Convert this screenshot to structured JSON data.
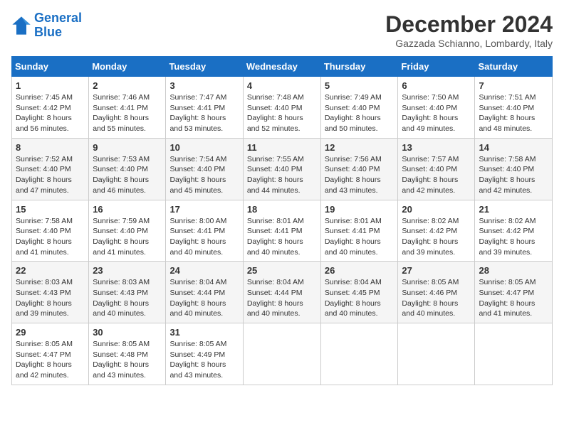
{
  "logo": {
    "line1": "General",
    "line2": "Blue"
  },
  "title": "December 2024",
  "subtitle": "Gazzada Schianno, Lombardy, Italy",
  "weekdays": [
    "Sunday",
    "Monday",
    "Tuesday",
    "Wednesday",
    "Thursday",
    "Friday",
    "Saturday"
  ],
  "weeks": [
    [
      {
        "day": "1",
        "sunrise": "7:45 AM",
        "sunset": "4:42 PM",
        "daylight": "8 hours and 56 minutes."
      },
      {
        "day": "2",
        "sunrise": "7:46 AM",
        "sunset": "4:41 PM",
        "daylight": "8 hours and 55 minutes."
      },
      {
        "day": "3",
        "sunrise": "7:47 AM",
        "sunset": "4:41 PM",
        "daylight": "8 hours and 53 minutes."
      },
      {
        "day": "4",
        "sunrise": "7:48 AM",
        "sunset": "4:40 PM",
        "daylight": "8 hours and 52 minutes."
      },
      {
        "day": "5",
        "sunrise": "7:49 AM",
        "sunset": "4:40 PM",
        "daylight": "8 hours and 50 minutes."
      },
      {
        "day": "6",
        "sunrise": "7:50 AM",
        "sunset": "4:40 PM",
        "daylight": "8 hours and 49 minutes."
      },
      {
        "day": "7",
        "sunrise": "7:51 AM",
        "sunset": "4:40 PM",
        "daylight": "8 hours and 48 minutes."
      }
    ],
    [
      {
        "day": "8",
        "sunrise": "7:52 AM",
        "sunset": "4:40 PM",
        "daylight": "8 hours and 47 minutes."
      },
      {
        "day": "9",
        "sunrise": "7:53 AM",
        "sunset": "4:40 PM",
        "daylight": "8 hours and 46 minutes."
      },
      {
        "day": "10",
        "sunrise": "7:54 AM",
        "sunset": "4:40 PM",
        "daylight": "8 hours and 45 minutes."
      },
      {
        "day": "11",
        "sunrise": "7:55 AM",
        "sunset": "4:40 PM",
        "daylight": "8 hours and 44 minutes."
      },
      {
        "day": "12",
        "sunrise": "7:56 AM",
        "sunset": "4:40 PM",
        "daylight": "8 hours and 43 minutes."
      },
      {
        "day": "13",
        "sunrise": "7:57 AM",
        "sunset": "4:40 PM",
        "daylight": "8 hours and 42 minutes."
      },
      {
        "day": "14",
        "sunrise": "7:58 AM",
        "sunset": "4:40 PM",
        "daylight": "8 hours and 42 minutes."
      }
    ],
    [
      {
        "day": "15",
        "sunrise": "7:58 AM",
        "sunset": "4:40 PM",
        "daylight": "8 hours and 41 minutes."
      },
      {
        "day": "16",
        "sunrise": "7:59 AM",
        "sunset": "4:40 PM",
        "daylight": "8 hours and 41 minutes."
      },
      {
        "day": "17",
        "sunrise": "8:00 AM",
        "sunset": "4:41 PM",
        "daylight": "8 hours and 40 minutes."
      },
      {
        "day": "18",
        "sunrise": "8:01 AM",
        "sunset": "4:41 PM",
        "daylight": "8 hours and 40 minutes."
      },
      {
        "day": "19",
        "sunrise": "8:01 AM",
        "sunset": "4:41 PM",
        "daylight": "8 hours and 40 minutes."
      },
      {
        "day": "20",
        "sunrise": "8:02 AM",
        "sunset": "4:42 PM",
        "daylight": "8 hours and 39 minutes."
      },
      {
        "day": "21",
        "sunrise": "8:02 AM",
        "sunset": "4:42 PM",
        "daylight": "8 hours and 39 minutes."
      }
    ],
    [
      {
        "day": "22",
        "sunrise": "8:03 AM",
        "sunset": "4:43 PM",
        "daylight": "8 hours and 39 minutes."
      },
      {
        "day": "23",
        "sunrise": "8:03 AM",
        "sunset": "4:43 PM",
        "daylight": "8 hours and 40 minutes."
      },
      {
        "day": "24",
        "sunrise": "8:04 AM",
        "sunset": "4:44 PM",
        "daylight": "8 hours and 40 minutes."
      },
      {
        "day": "25",
        "sunrise": "8:04 AM",
        "sunset": "4:44 PM",
        "daylight": "8 hours and 40 minutes."
      },
      {
        "day": "26",
        "sunrise": "8:04 AM",
        "sunset": "4:45 PM",
        "daylight": "8 hours and 40 minutes."
      },
      {
        "day": "27",
        "sunrise": "8:05 AM",
        "sunset": "4:46 PM",
        "daylight": "8 hours and 40 minutes."
      },
      {
        "day": "28",
        "sunrise": "8:05 AM",
        "sunset": "4:47 PM",
        "daylight": "8 hours and 41 minutes."
      }
    ],
    [
      {
        "day": "29",
        "sunrise": "8:05 AM",
        "sunset": "4:47 PM",
        "daylight": "8 hours and 42 minutes."
      },
      {
        "day": "30",
        "sunrise": "8:05 AM",
        "sunset": "4:48 PM",
        "daylight": "8 hours and 43 minutes."
      },
      {
        "day": "31",
        "sunrise": "8:05 AM",
        "sunset": "4:49 PM",
        "daylight": "8 hours and 43 minutes."
      },
      null,
      null,
      null,
      null
    ]
  ]
}
